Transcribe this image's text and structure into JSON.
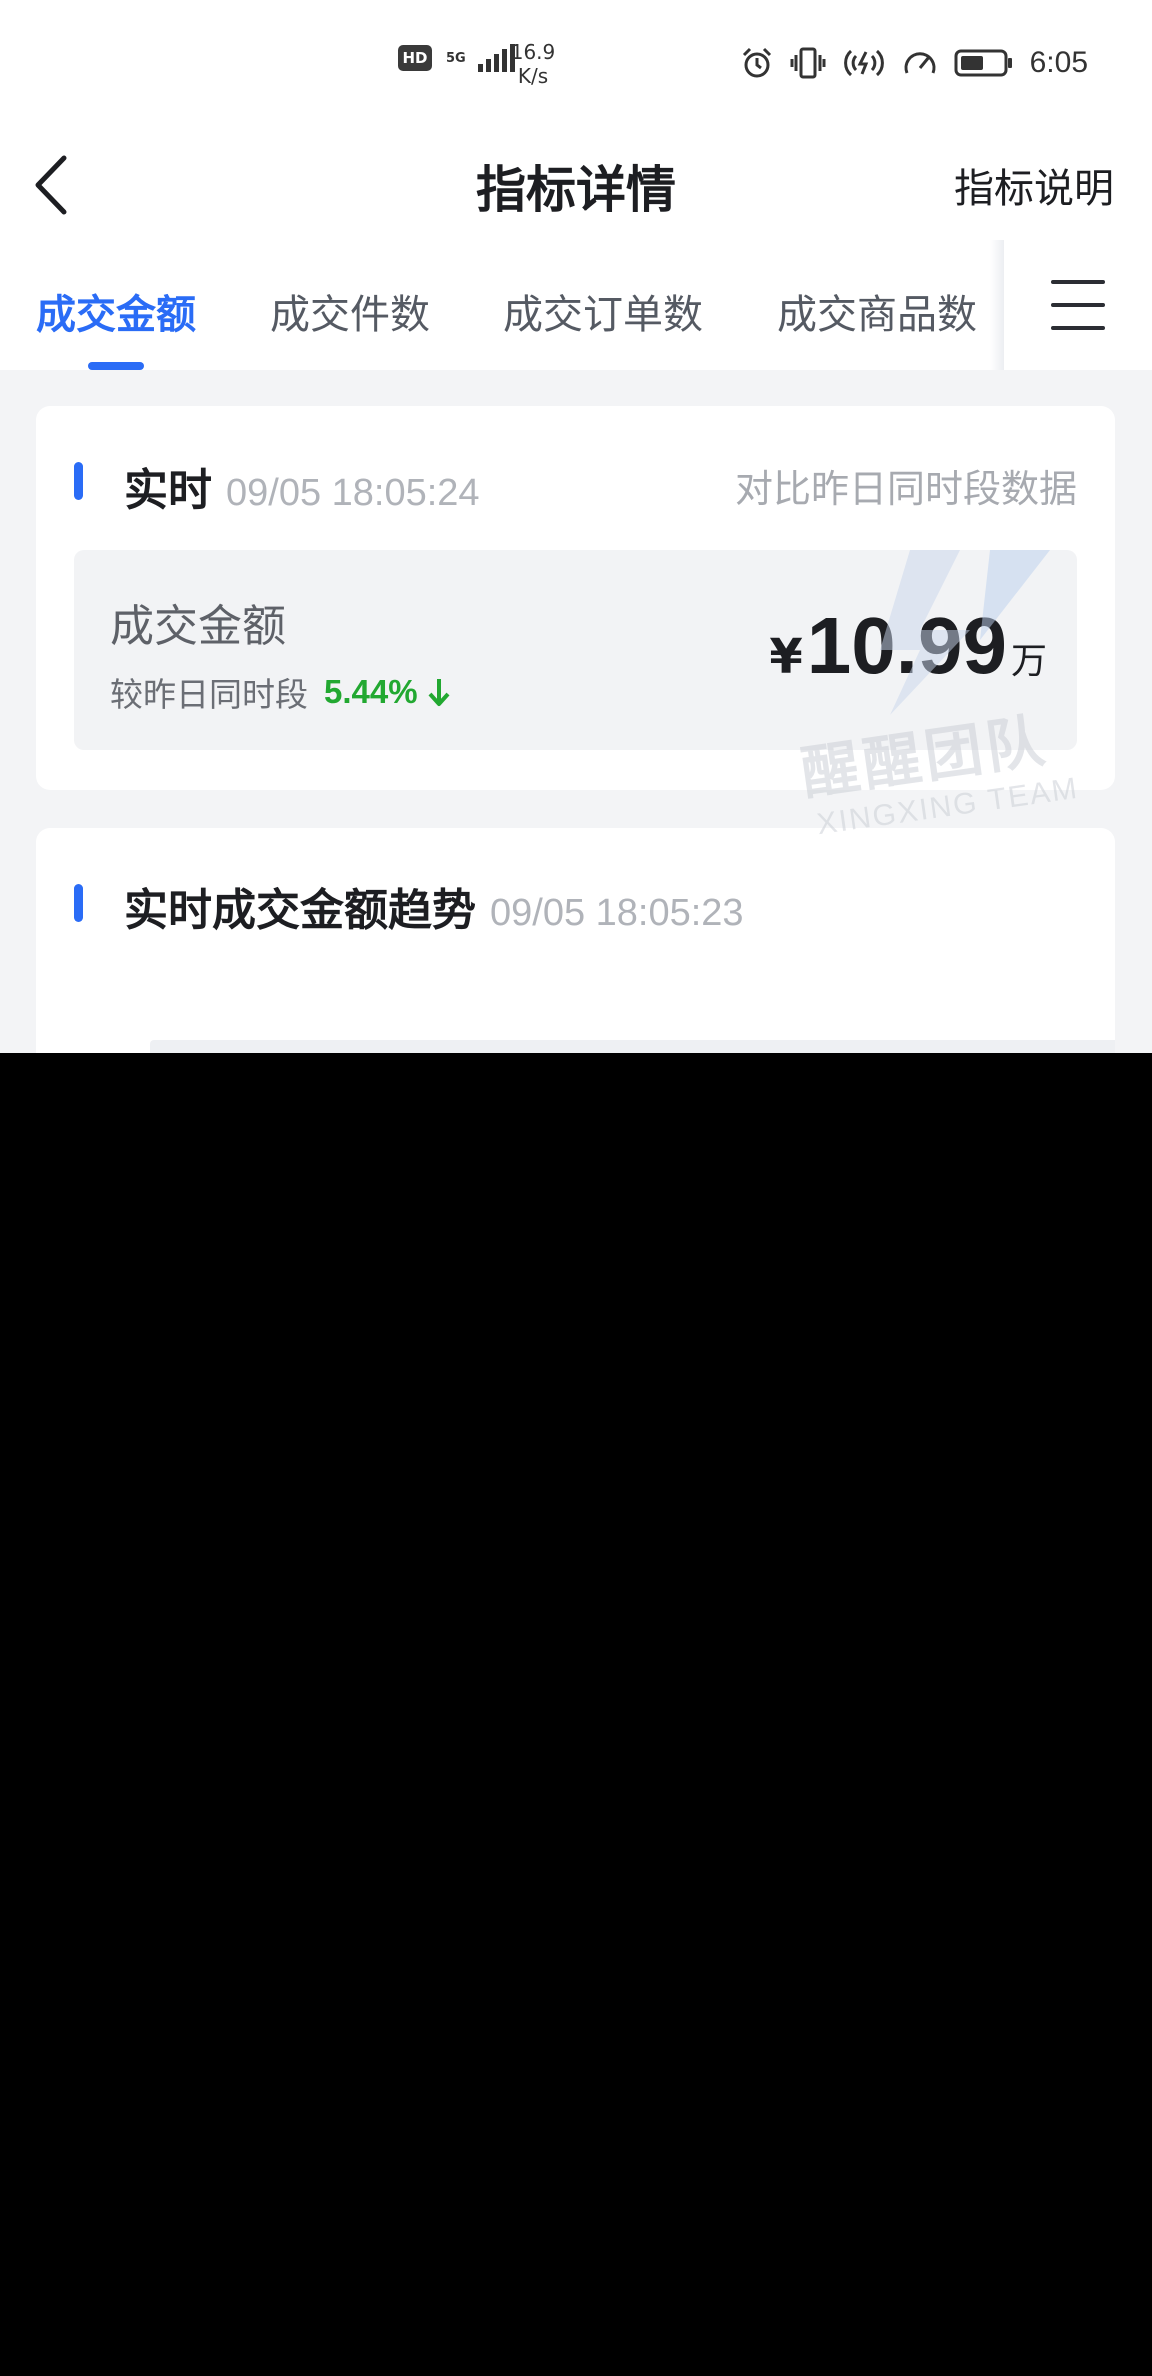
{
  "status_bar": {
    "hd": "HD",
    "network": "5G",
    "speed_value": "16.9",
    "speed_unit": "K/s",
    "time": "6:05",
    "icons": [
      "alarm-icon",
      "vibrate-icon",
      "hotspot-icon",
      "speedometer-icon",
      "battery-icon"
    ]
  },
  "nav": {
    "title": "指标详情",
    "help_label": "指标说明",
    "back_icon": "chevron-left-icon"
  },
  "tabs": {
    "items": [
      {
        "label": "成交金额",
        "active": true
      },
      {
        "label": "成交件数",
        "active": false
      },
      {
        "label": "成交订单数",
        "active": false
      },
      {
        "label": "成交商品数",
        "active": false
      }
    ],
    "menu_icon": "hamburger-menu-icon"
  },
  "realtime": {
    "title": "实时",
    "timestamp": "09/05 18:05:24",
    "compare_link": "对比昨日同时段数据",
    "metric_label": "成交金额",
    "compare_text": "较昨日同时段",
    "change_pct": "5.44%",
    "change_direction": "down",
    "currency": "¥",
    "value": "10.99",
    "unit": "万"
  },
  "trend": {
    "title": "实时成交金额趋势",
    "timestamp": "09/05 18:05:23"
  },
  "watermark": {
    "text": "醒醒团队",
    "subtext": "XINGXING TEAM"
  },
  "colors": {
    "accent": "#2a6cf6",
    "positive_down": "#22a831",
    "background": "#f3f4f6"
  }
}
